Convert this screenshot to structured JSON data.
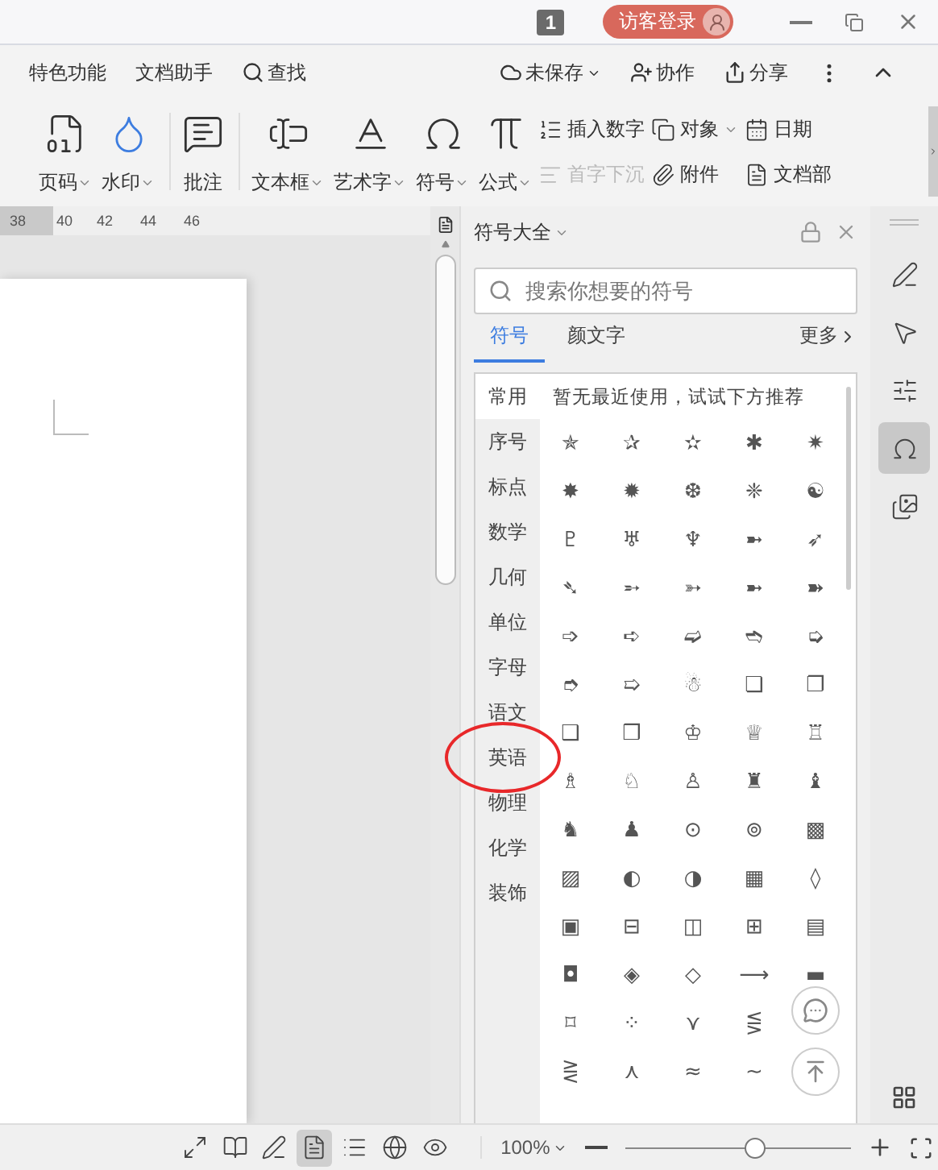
{
  "title_bar": {
    "badge": "1",
    "login_button": "访客登录"
  },
  "menu": {
    "items": [
      {
        "label": "特色功能"
      },
      {
        "label": "文档助手"
      }
    ],
    "find": "查找",
    "save_status": "未保存",
    "collab": "协作",
    "share": "分享"
  },
  "ribbon": {
    "large": [
      {
        "kind": "page-number",
        "label": "页码",
        "dropdown": true
      },
      {
        "kind": "watermark",
        "label": "水印",
        "dropdown": true
      },
      {
        "kind": "comment",
        "label": "批注",
        "dropdown": false
      },
      {
        "kind": "textbox",
        "label": "文本框",
        "dropdown": true
      },
      {
        "kind": "wordart",
        "label": "艺术字",
        "dropdown": true
      },
      {
        "kind": "symbol",
        "label": "符号",
        "dropdown": true
      },
      {
        "kind": "formula",
        "label": "公式",
        "dropdown": true
      }
    ],
    "small": [
      [
        {
          "kind": "number",
          "label": "插入数字",
          "dropdown": false,
          "disabled": false
        },
        {
          "kind": "dropcap",
          "label": "首字下沉",
          "dropdown": false,
          "disabled": true
        }
      ],
      [
        {
          "kind": "object",
          "label": "对象",
          "dropdown": true,
          "disabled": false
        },
        {
          "kind": "attach",
          "label": "附件",
          "dropdown": false,
          "disabled": false
        }
      ],
      [
        {
          "kind": "date",
          "label": "日期",
          "dropdown": false,
          "disabled": false
        },
        {
          "kind": "parts",
          "label": "文档部",
          "dropdown": false,
          "disabled": false
        }
      ]
    ]
  },
  "ruler": {
    "ticks": [
      "38",
      "40",
      "42",
      "44",
      "46"
    ]
  },
  "symbol_panel": {
    "title": "符号大全",
    "search": {
      "placeholder": "搜索你想要的符号"
    },
    "tabs": [
      {
        "label": "符号",
        "selected": true
      },
      {
        "label": "颜文字",
        "selected": false
      }
    ],
    "more": "更多",
    "categories": [
      {
        "label": "常用",
        "selected": true
      },
      {
        "label": "序号",
        "selected": false
      },
      {
        "label": "标点",
        "selected": false
      },
      {
        "label": "数学",
        "selected": false
      },
      {
        "label": "几何",
        "selected": false
      },
      {
        "label": "单位",
        "selected": false
      },
      {
        "label": "字母",
        "selected": false
      },
      {
        "label": "语文",
        "selected": false
      },
      {
        "label": "英语",
        "selected": false
      },
      {
        "label": "物理",
        "selected": false
      },
      {
        "label": "化学",
        "selected": false
      },
      {
        "label": "装饰",
        "selected": false
      }
    ],
    "hint": "暂无最近使用，试试下方推荐",
    "symbols": [
      [
        "✯",
        "✰",
        "✫",
        "✱",
        "✷"
      ],
      [
        "✸",
        "✹",
        "❆",
        "❈",
        "☯"
      ],
      [
        "♇",
        "♅",
        "♆",
        "➼",
        "➶"
      ],
      [
        "➴",
        "➵",
        "➳",
        "➼",
        "➽"
      ],
      [
        "➩",
        "➪",
        "➫",
        "➬",
        "➭"
      ],
      [
        "➮",
        "➯",
        "☃",
        "❏",
        "❐"
      ],
      [
        "❑",
        "❒",
        "♔",
        "♕",
        "♖"
      ],
      [
        "♗",
        "♘",
        "♙",
        "♜",
        "♝"
      ],
      [
        "♞",
        "♟",
        "⊙",
        "⊚",
        "▩"
      ],
      [
        "▨",
        "◐",
        "◑",
        "▦",
        "◊"
      ],
      [
        "▣",
        "⊟",
        "◫",
        "⊞",
        "▤"
      ],
      [
        "◘",
        "◈",
        "◇",
        "⟶",
        "▬"
      ],
      [
        "⌑",
        "⁘",
        "⋎",
        "⋚"
      ],
      [
        "⋛",
        "⋏",
        "≈",
        "∼"
      ]
    ]
  },
  "sidebar": {
    "items": [
      {
        "kind": "pen",
        "selected": false
      },
      {
        "kind": "cursor",
        "selected": false
      },
      {
        "kind": "sliders",
        "selected": false
      },
      {
        "kind": "omega",
        "selected": true
      },
      {
        "kind": "image",
        "selected": false
      }
    ]
  },
  "status_bar": {
    "views": [
      {
        "kind": "fullscreen",
        "selected": false
      },
      {
        "kind": "read",
        "selected": false
      },
      {
        "kind": "write",
        "selected": false
      },
      {
        "kind": "page",
        "selected": true
      },
      {
        "kind": "outline",
        "selected": false
      },
      {
        "kind": "web",
        "selected": false
      },
      {
        "kind": "eye",
        "selected": false
      }
    ],
    "zoom": "100%",
    "zoom_slider": {
      "level": 0.57
    }
  }
}
